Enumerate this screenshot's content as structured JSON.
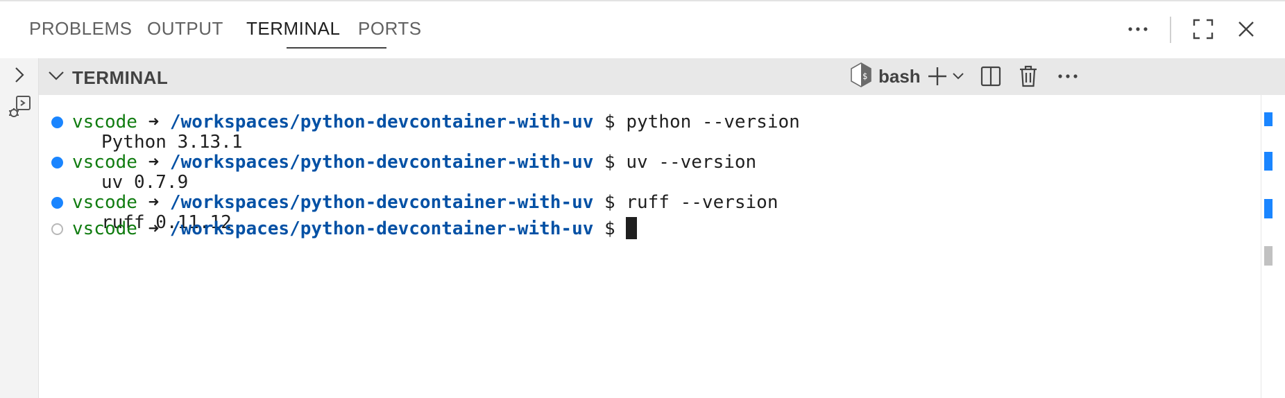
{
  "panel": {
    "tabs": [
      {
        "label": "PROBLEMS"
      },
      {
        "label": "OUTPUT"
      },
      {
        "label": "TERMINAL",
        "active": true
      },
      {
        "label": "PORTS"
      }
    ],
    "actions": [
      "more-icon",
      "maximize-icon",
      "close-icon"
    ]
  },
  "rail": {
    "icons": [
      "chevron-right-icon",
      "debug-console-icon"
    ]
  },
  "terminal_section": {
    "title": "TERMINAL",
    "shell_label": "bash",
    "actions": [
      "new-terminal-icon",
      "split-icon",
      "trash-icon",
      "more-icon"
    ]
  },
  "terminal": {
    "user": "vscode",
    "arrow": "➜",
    "path": "/workspaces/python-devcontainer-with-uv",
    "prompt_symbol": "$",
    "entries": [
      {
        "command": "python --version",
        "output": "Python 3.13.1"
      },
      {
        "command": "uv --version",
        "output": "uv 0.7.9"
      },
      {
        "command": "ruff --version",
        "output": "ruff 0.11.12"
      }
    ],
    "current_command": ""
  },
  "colors": {
    "accent": "#1a85ff",
    "prompt_user": "#107c10",
    "prompt_path": "#0451a5"
  }
}
